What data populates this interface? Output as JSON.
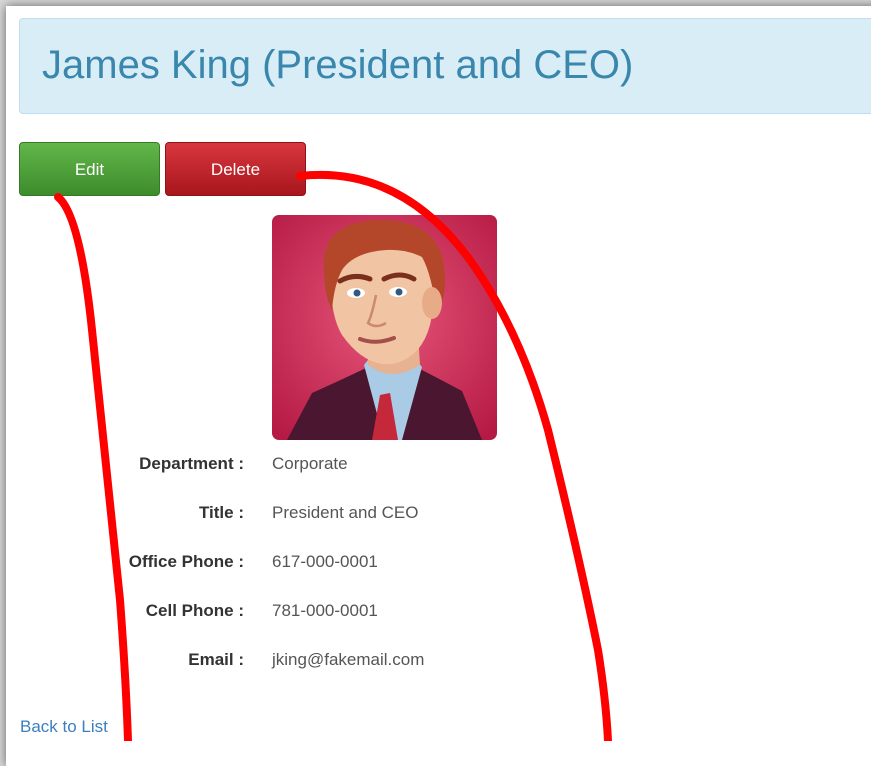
{
  "page": {
    "title": "James King (President and CEO)"
  },
  "actions": {
    "edit_label": "Edit",
    "delete_label": "Delete"
  },
  "employee": {
    "fields": [
      {
        "label": "Department :",
        "value": "Corporate"
      },
      {
        "label": "Title :",
        "value": "President and CEO"
      },
      {
        "label": "Office Phone :",
        "value": "617-000-0001"
      },
      {
        "label": "Cell Phone :",
        "value": "781-000-0001"
      },
      {
        "label": "Email :",
        "value": "jking@fakemail.com"
      }
    ]
  },
  "footer": {
    "back_link": "Back to List"
  },
  "colors": {
    "header_bg": "#d9edf7",
    "header_text": "#3a87ad",
    "edit_button": "#4ea23a",
    "delete_button": "#c0252c",
    "link": "#3a7fc1",
    "annotation_arrow": "#ff0000"
  }
}
